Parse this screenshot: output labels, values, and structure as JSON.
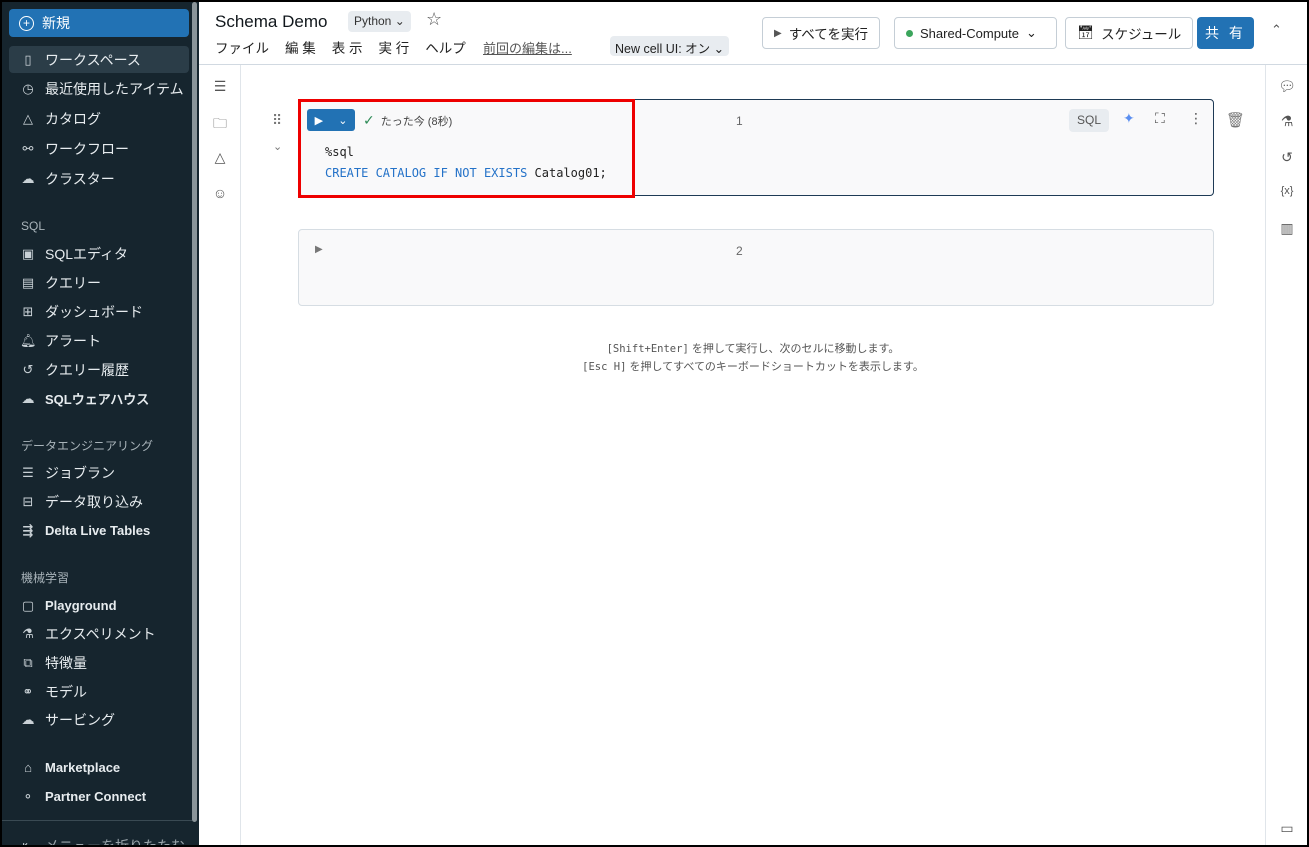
{
  "sidebar": {
    "new_label": "新規",
    "items_top": [
      {
        "icon": "workspace-icon",
        "label": "ワークスペース"
      },
      {
        "icon": "clock-icon",
        "label": "最近使用したアイテム"
      },
      {
        "icon": "catalog-icon",
        "label": "カタログ"
      },
      {
        "icon": "workflow-icon",
        "label": "ワークフロー"
      },
      {
        "icon": "cloud-icon",
        "label": "クラスター"
      }
    ],
    "sql_header": "SQL",
    "items_sql": [
      {
        "label": "SQLエディタ"
      },
      {
        "label": "クエリー"
      },
      {
        "label": "ダッシュボード"
      },
      {
        "label": "アラート"
      },
      {
        "label": "クエリー履歴"
      },
      {
        "label": "SQLウェアハウス"
      }
    ],
    "de_header": "データエンジニアリング",
    "items_de": [
      {
        "label": "ジョブラン"
      },
      {
        "label": "データ取り込み"
      },
      {
        "label": "Delta Live Tables"
      }
    ],
    "ml_header": "機械学習",
    "items_ml": [
      {
        "label": "Playground"
      },
      {
        "label": "エクスペリメント"
      },
      {
        "label": "特徴量"
      },
      {
        "label": "モデル"
      },
      {
        "label": "サービング"
      }
    ],
    "items_bottom": [
      {
        "label": "Marketplace"
      },
      {
        "label": "Partner Connect"
      }
    ],
    "collapse_label": "メニューを折りたたむ"
  },
  "header": {
    "title": "Schema Demo",
    "language": "Python",
    "menu": [
      "ファイル",
      "編 集",
      "表 示",
      "実 行",
      "ヘルプ"
    ],
    "last_edit": "前回の編集は...",
    "new_cell_ui": "New cell UI: オン",
    "run_all": "すべてを実行",
    "compute": "Shared-Compute",
    "schedule": "スケジュール",
    "share": "共 有",
    "compute_status_color": "#3ba55c"
  },
  "cells": [
    {
      "number": "1",
      "status": "たった今 (8秒)",
      "lang_tag": "SQL",
      "code_line1": "%sql",
      "kw": "CREATE CATALOG IF NOT EXISTS",
      "ident": "Catalog01;"
    },
    {
      "number": "2"
    }
  ],
  "hints": {
    "h1_key": "[Shift+Enter]",
    "h1_text": " を押して実行し、次のセルに移動します。",
    "h2_key": "[Esc H]",
    "h2_text": " を押してすべてのキーボードショートカットを表示します。"
  }
}
